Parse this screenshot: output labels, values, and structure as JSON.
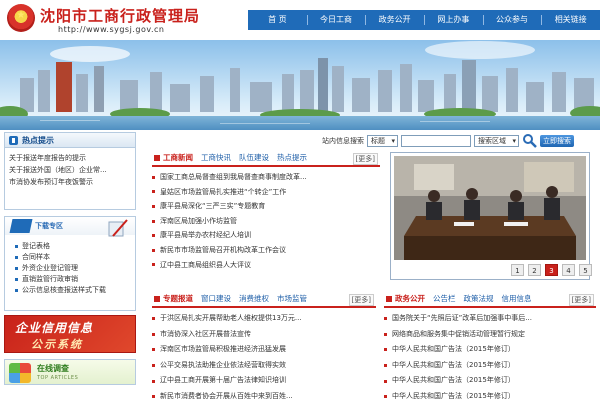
{
  "header": {
    "title": "沈阳市工商行政管理局",
    "url": "http://www.sygsj.gov.cn"
  },
  "topnav": [
    "首 页",
    "今日工商",
    "政务公开",
    "网上办事",
    "公众参与",
    "相关链接"
  ],
  "sidebar": {
    "hot": {
      "title": "热点提示",
      "items": [
        "关于报送年度报告的提示",
        "关于报送外国（地区）企业常...",
        "市消协发布预订年夜饭警示"
      ]
    },
    "download": {
      "title": "下载专区",
      "items": [
        "登记表格",
        "合同样本",
        "外资企业登记管理",
        "直销监管行政审销",
        "公示信息核查报送样式下载"
      ]
    },
    "credit_banner": {
      "line1": "企业信用信息",
      "line2": "公示系统"
    },
    "survey": {
      "title": "在线调查",
      "subtitle": "TOP ARTICLES"
    }
  },
  "search": {
    "label": "站内信息搜索",
    "category": "标题",
    "scope_placeholder": "搜索区域",
    "button": "立即搜索"
  },
  "news": {
    "tabs": [
      "工商新闻",
      "工商快讯",
      "队伍建设",
      "热点提示"
    ],
    "more": "[更多]",
    "items": [
      "国家工商总局督查组到我局督查商事制度改革...",
      "皇姑区市场监管局扎实推进“个转企”工作",
      "康平县局深化“三严三实”专题教育",
      "浑南区局加强小作坊监管",
      "康平县局举办农村经纪人培训",
      "新民市市场监管局召开机构改革工作会议",
      "辽中县工商局组织县人大评议"
    ]
  },
  "photo_pager": [
    "1",
    "2",
    "3",
    "4",
    "5"
  ],
  "photo_pager_active": "3",
  "special": {
    "tabs": [
      "专题报道",
      "窗口建设",
      "消费维权",
      "市场监管"
    ],
    "more": "[更多]",
    "items": [
      "于洪区局扎实开展帮助老人维权提供13万元...",
      "市消协深入社区开展普法宣传",
      "浑南区市场监管局积极推进经济迅猛发展",
      "公平交易执法助推企业依法经营取得实效",
      "辽中县工商开展第十届广告法律知识培训",
      "新民市消费者协会开展从百姓中来到百姓..."
    ]
  },
  "affairs": {
    "tabs": [
      "政务公开",
      "公告栏",
      "政策法规",
      "信用信息"
    ],
    "more": "[更多]",
    "items": [
      "国务院关于“先照后证”改革后加强事中事后...",
      "网络商品和服务集中促销活动管理暂行规定",
      "中华人民共和国广告法（2015年修订）",
      "中华人民共和国广告法（2015年修订）",
      "中华人民共和国广告法（2015年修订）",
      "中华人民共和国广告法（2015年修订）"
    ]
  },
  "colors": {
    "brand_red": "#c9211c",
    "nav_blue": "#1f6bb8"
  }
}
